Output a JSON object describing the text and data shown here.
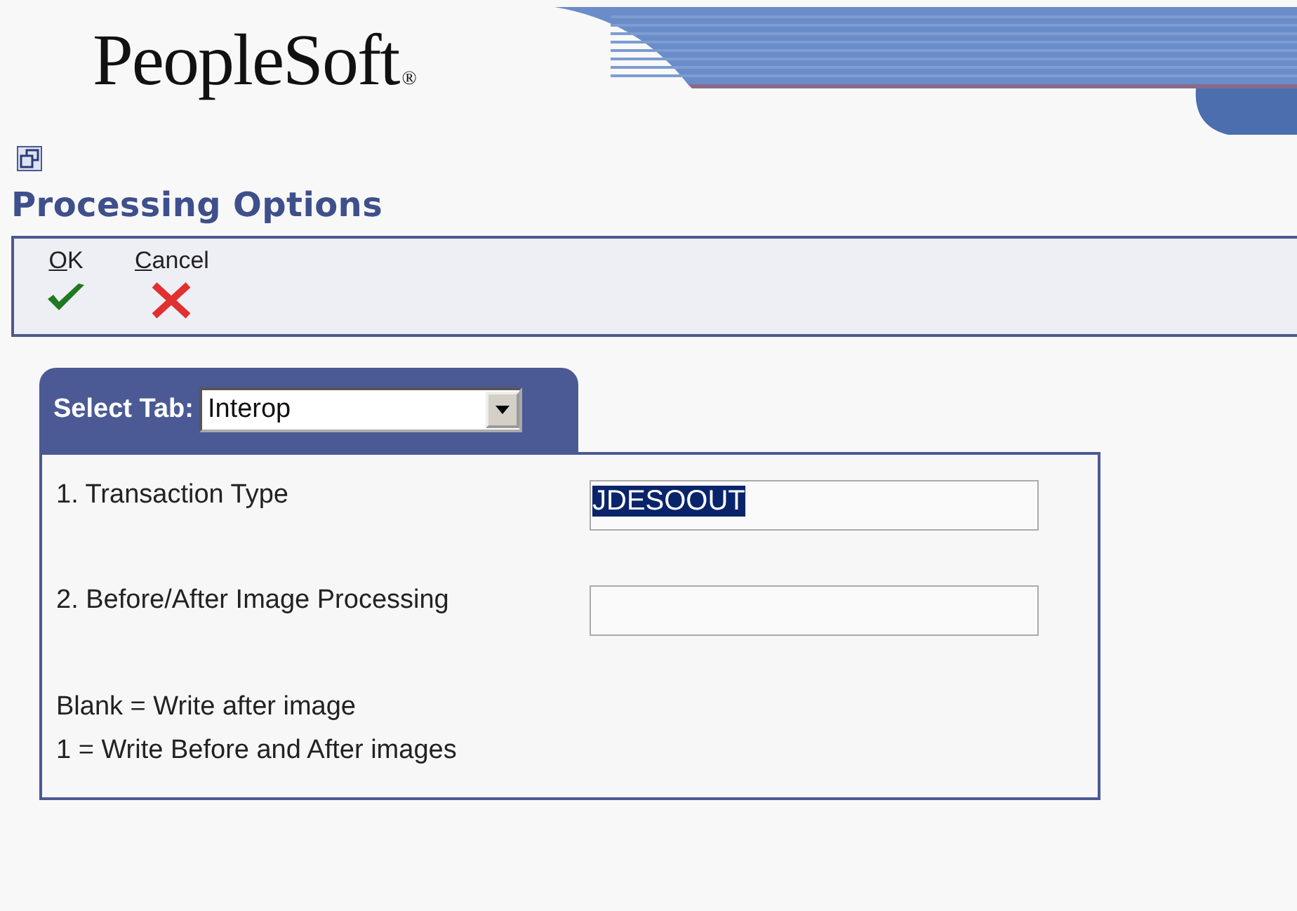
{
  "header": {
    "logo": "PeopleSoft",
    "logo_mark": "®"
  },
  "page": {
    "title": "Processing Options"
  },
  "toolbar": [
    {
      "kind": "ok",
      "label": "OK"
    },
    {
      "kind": "cancel",
      "label": "Cancel"
    }
  ],
  "tab_selector": {
    "label": "Select Tab:",
    "value": "Interop"
  },
  "options": [
    {
      "label": "1. Transaction Type",
      "value": "JDESOOUT",
      "value_selected": true
    },
    {
      "label": "2. Before/After Image Processing",
      "value_selected": false
    }
  ],
  "notes": [
    "Blank = Write after image",
    "1 = Write Before and After images"
  ]
}
